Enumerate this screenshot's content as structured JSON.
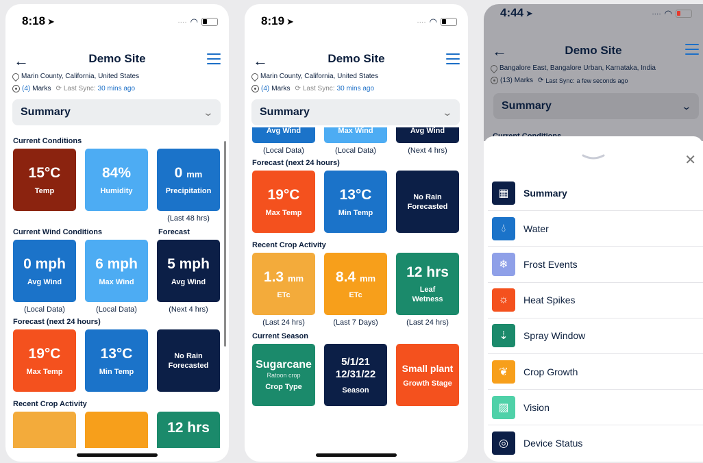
{
  "screens": [
    {
      "time": "8:18",
      "title": "Demo Site",
      "location": "Marin County, California, United States",
      "marks_count": "(4)",
      "marks_label": "Marks",
      "sync_label": "Last Sync:",
      "sync_value": "30 mins ago",
      "dropdown": "Summary"
    },
    {
      "time": "8:19",
      "title": "Demo Site",
      "location": "Marin County, California, United States",
      "marks_count": "(4)",
      "marks_label": "Marks",
      "sync_label": "Last Sync:",
      "sync_value": "30 mins ago",
      "dropdown": "Summary"
    },
    {
      "time": "4:44",
      "title": "Demo Site",
      "location": "Bangalore East, Bangalore Urban, Karnataka, India",
      "marks_count": "(13)",
      "marks_label": "Marks",
      "sync_label": "Last Sync:",
      "sync_value": "a few seconds ago",
      "dropdown": "Summary",
      "peek_section": "Current Conditions"
    }
  ],
  "sections": {
    "current_conditions": "Current Conditions",
    "current_wind": "Current Wind Conditions",
    "forecast": "Forecast",
    "forecast_24": "Forecast (next 24 hours)",
    "crop_activity": "Recent Crop Activity",
    "current_season": "Current Season"
  },
  "tiles": {
    "temp": {
      "value": "15°C",
      "label": "Temp",
      "color": "#8b230f"
    },
    "humidity": {
      "value": "84%",
      "label": "Humidity",
      "color": "#4dacf3"
    },
    "precip": {
      "value": "0",
      "unit": "mm",
      "label": "Precipitation",
      "caption": "(Last 48 hrs)",
      "color": "#1b73c9"
    },
    "avg_wind": {
      "value": "0 mph",
      "label": "Avg Wind",
      "caption": "(Local Data)"
    },
    "max_wind": {
      "value": "6 mph",
      "label": "Max Wind",
      "caption": "(Local Data)"
    },
    "fc_wind": {
      "value": "5 mph",
      "label": "Avg Wind",
      "caption": "(Next 4 hrs)"
    },
    "max_temp": {
      "value": "19°C",
      "label": "Max Temp"
    },
    "min_temp": {
      "value": "13°C",
      "label": "Min Temp"
    },
    "rain": {
      "line1": "No Rain",
      "line2": "Forecasted"
    },
    "etc_24": {
      "value": "1.3",
      "unit": "mm",
      "label": "ETc",
      "caption": "(Last 24 hrs)"
    },
    "etc_7": {
      "value": "8.4",
      "unit": "mm",
      "label": "ETc",
      "caption": "(Last 7 Days)"
    },
    "leaf": {
      "value": "12 hrs",
      "line1": "Leaf",
      "line2": "Wetness",
      "caption": "(Last 24 hrs)",
      "peek": "12 hrs"
    },
    "crop": {
      "value": "Sugarcane",
      "sub": "Ratoon crop",
      "label": "Crop Type"
    },
    "season": {
      "line1": "5/1/21",
      "line2": "12/31/22",
      "label": "Season"
    },
    "stage": {
      "value": "Small plant",
      "label": "Growth Stage"
    }
  },
  "menu": [
    {
      "label": "Summary",
      "icon": "grid-icon",
      "color": "#0c1f47",
      "active": true
    },
    {
      "label": "Water",
      "icon": "water-drop-icon",
      "color": "#1b73c9"
    },
    {
      "label": "Frost Events",
      "icon": "snowflake-icon",
      "color": "#8fa0e8"
    },
    {
      "label": "Heat Spikes",
      "icon": "sun-icon",
      "color": "#f4511e"
    },
    {
      "label": "Spray Window",
      "icon": "sprayer-icon",
      "color": "#1b8a6b"
    },
    {
      "label": "Crop Growth",
      "icon": "sprout-icon",
      "color": "#f79f1b"
    },
    {
      "label": "Vision",
      "icon": "image-icon",
      "color": "#4fd1a8"
    },
    {
      "label": "Device Status",
      "icon": "device-icon",
      "color": "#0c1f47"
    }
  ]
}
